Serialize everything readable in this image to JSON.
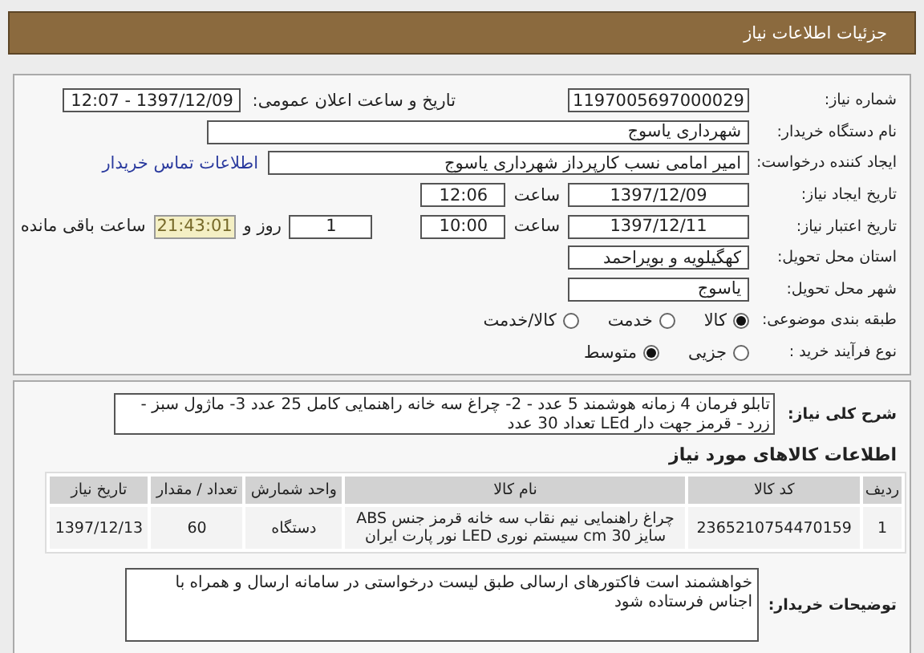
{
  "header": {
    "title": "جزئیات اطلاعات نیاز"
  },
  "need_number": {
    "label": "شماره نیاز:",
    "value": "1197005697000029"
  },
  "announce": {
    "label": "تاریخ و ساعت اعلان عمومی:",
    "value": "1397/12/09 - 12:07"
  },
  "buyer": {
    "label": "نام دستگاه خریدار:",
    "value": "شهرداری یاسوج"
  },
  "creator": {
    "label": "ایجاد کننده درخواست:",
    "value": "امیر امامی نسب کارپرداز شهرداری یاسوج",
    "link": "اطلاعات تماس خریدار"
  },
  "created": {
    "label": "تاریخ ایجاد نیاز:",
    "date": "1397/12/09",
    "time_label": "ساعت",
    "time": "12:06"
  },
  "validity": {
    "label": "تاریخ اعتبار نیاز:",
    "date": "1397/12/11",
    "time_label": "ساعت",
    "time": "10:00",
    "days": "1",
    "days_label": "روز و",
    "remaining": "21:43:01",
    "remaining_label": "ساعت باقی مانده"
  },
  "province": {
    "label": "استان محل تحویل:",
    "value": "کهگیلویه و بویراحمد"
  },
  "city": {
    "label": "شهر محل تحویل:",
    "value": "یاسوج"
  },
  "category": {
    "label": "طبقه بندی موضوعی:",
    "options": [
      {
        "label": "کالا",
        "selected": true
      },
      {
        "label": "خدمت",
        "selected": false
      },
      {
        "label": "کالا/خدمت",
        "selected": false
      }
    ]
  },
  "process": {
    "label": "نوع فرآیند خرید :",
    "options": [
      {
        "label": "جزیی",
        "selected": false
      },
      {
        "label": "متوسط",
        "selected": true
      }
    ]
  },
  "description": {
    "label": "شرح کلی نیاز:",
    "value": "تابلو فرمان 4 زمانه هوشمند 5 عدد - 2- چراغ سه خانه راهنمایی کامل 25 عدد 3- ماژول سبز - زرد - قرمز جهت دار LEd تعداد 30 عدد"
  },
  "items_title": "اطلاعات کالاهای مورد نیاز",
  "table": {
    "columns": [
      "ردیف",
      "کد کالا",
      "نام کالا",
      "واحد شمارش",
      "تعداد / مقدار",
      "تاریخ نیاز"
    ],
    "rows": [
      [
        "1",
        "2365210754470159",
        "چراغ راهنمایی نیم نقاب سه خانه قرمز جنس ABS سایز 30 cm سیستم نوری LED نور پارت ایران",
        "دستگاه",
        "60",
        "1397/12/13"
      ]
    ]
  },
  "buyer_notes": {
    "label": "توضیحات خریدار:",
    "value": "خواهشمند است فاکتورهای ارسالی طبق لیست درخواستی در سامانه ارسال و همراه با اجناس فرستاده شود"
  }
}
